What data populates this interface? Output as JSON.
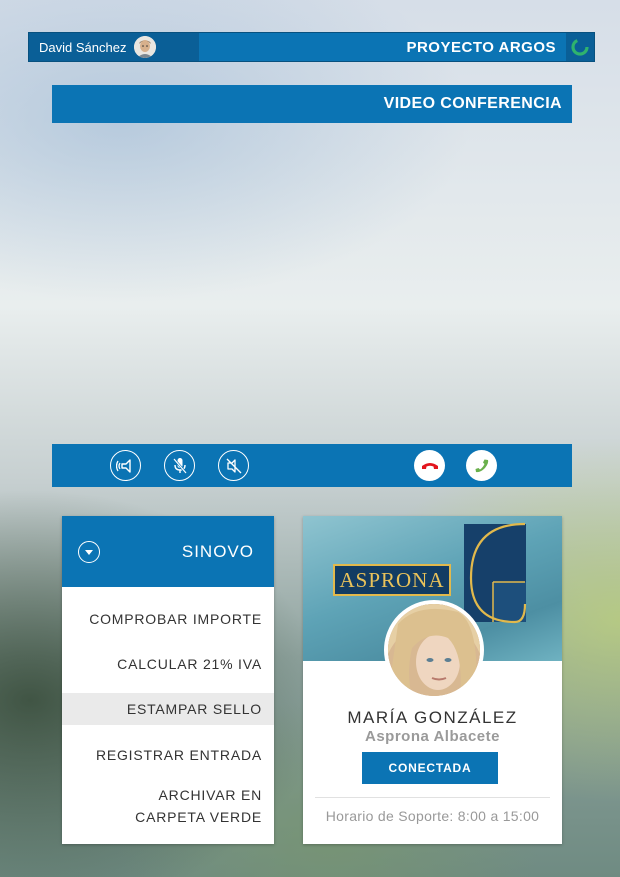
{
  "header": {
    "user_name": "David Sánchez",
    "app_title": "PROYECTO ARGOS",
    "avatar_icon": "user-avatar",
    "logo_icon": "argos-logo"
  },
  "section": {
    "title": "VIDEO CONFERENCIA"
  },
  "call_controls": {
    "speaker_icon": "speaker-icon",
    "mic_icon": "microphone-icon",
    "camera_off_icon": "camera-off-icon",
    "hangup_icon": "phone-hangup-icon",
    "answer_icon": "phone-answer-icon",
    "hangup_color": "#e3151e",
    "answer_color": "#6ab04c"
  },
  "menu": {
    "title": "SINOVO",
    "items": [
      {
        "label": "COMPROBAR IMPORTE"
      },
      {
        "label": "CALCULAR 21% IVA"
      },
      {
        "label": "ESTAMPAR SELLO"
      },
      {
        "label": "REGISTRAR ENTRADA"
      },
      {
        "label": "ARCHIVAR EN CARPETA VERDE"
      }
    ]
  },
  "contact": {
    "company_logo_text": "ASPRONA",
    "name": "MARÍA GONZÁLEZ",
    "company": "Asprona Albacete",
    "status_button": "CONECTADA",
    "support_hours": "Horario de Soporte: 8:00 a 15:00"
  },
  "colors": {
    "primary": "#0b74b4",
    "primary_dark": "#0a5f97",
    "logo_gold": "#e2b94c",
    "logo_navy": "#123c63"
  }
}
